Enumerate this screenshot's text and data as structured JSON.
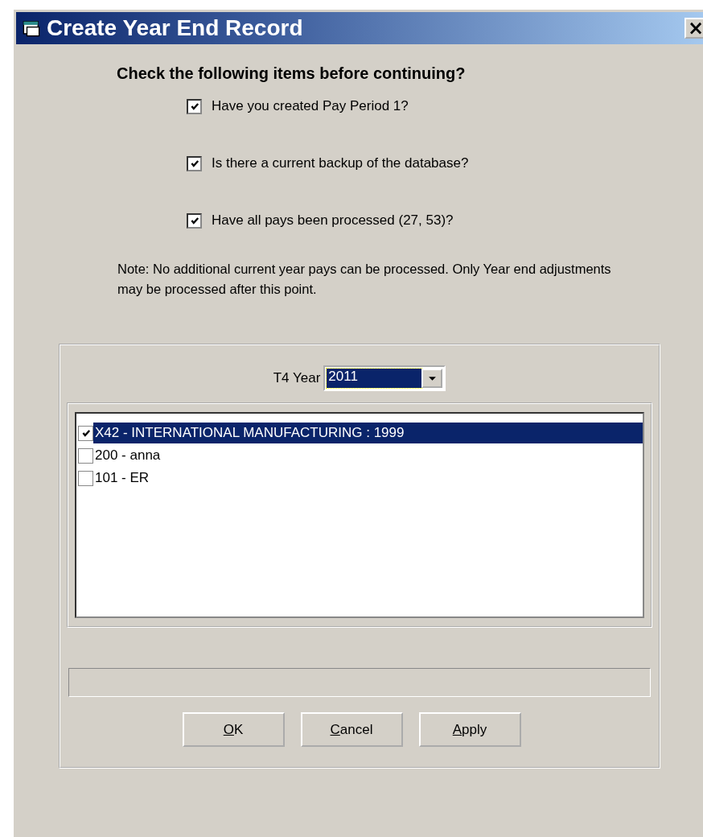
{
  "window": {
    "title": "Create Year End Record",
    "close": "×"
  },
  "heading": "Check the following items before continuing?",
  "checks": [
    {
      "label": "Have you created Pay Period 1?",
      "checked": true
    },
    {
      "label": "Is there a current backup of the database?",
      "checked": true
    },
    {
      "label": "Have all pays been processed (27, 53)?",
      "checked": true
    }
  ],
  "note": "Note: No additional current year pays can be processed. Only Year end adjustments may be processed after this point.",
  "year": {
    "label": "T4 Year",
    "value": "2011",
    "focused": true
  },
  "companies": [
    {
      "label": "X42 - INTERNATIONAL MANUFACTURING  :  1999",
      "checked": true,
      "selected": true
    },
    {
      "label": "200 - anna",
      "checked": false,
      "selected": false
    },
    {
      "label": "101 - ER",
      "checked": false,
      "selected": false
    }
  ],
  "progress": {
    "level": 0
  },
  "buttons": [
    {
      "label": "OK",
      "underline_first": true
    },
    {
      "label": "Cancel",
      "underline_first": true
    },
    {
      "label": "Apply",
      "underline_first": true
    }
  ]
}
